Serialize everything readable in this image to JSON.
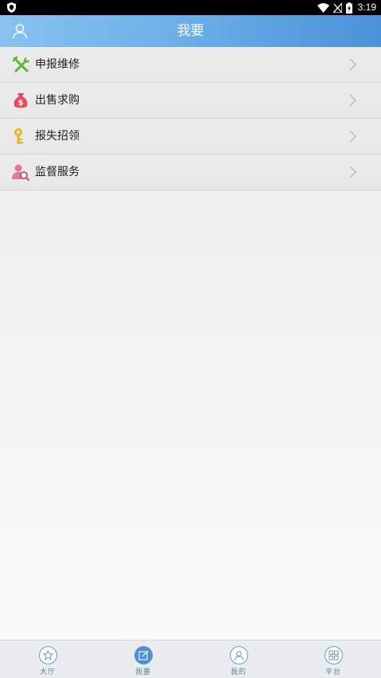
{
  "status_bar": {
    "time": "3:19"
  },
  "header": {
    "title": "我要",
    "user_icon": "user-icon"
  },
  "menu": {
    "items": [
      {
        "label": "申报维修",
        "icon": "wrench-screwdriver-icon",
        "color": "#5cb531"
      },
      {
        "label": "出售求购",
        "icon": "money-bag-icon",
        "color": "#e8495a"
      },
      {
        "label": "报失招领",
        "icon": "key-icon",
        "color": "#e9b522"
      },
      {
        "label": "监督服务",
        "icon": "person-search-icon",
        "color": "#e07a9a"
      }
    ]
  },
  "tabbar": {
    "tabs": [
      {
        "label": "大厅",
        "icon": "star-icon",
        "active": false
      },
      {
        "label": "我要",
        "icon": "edit-icon",
        "active": true
      },
      {
        "label": "我的",
        "icon": "person-icon",
        "active": false
      },
      {
        "label": "平台",
        "icon": "grid-icon",
        "active": false
      }
    ]
  },
  "colors": {
    "header_start": "#88c2f0",
    "header_end": "#4a92d8",
    "tab_accent": "#4f8fd6"
  }
}
